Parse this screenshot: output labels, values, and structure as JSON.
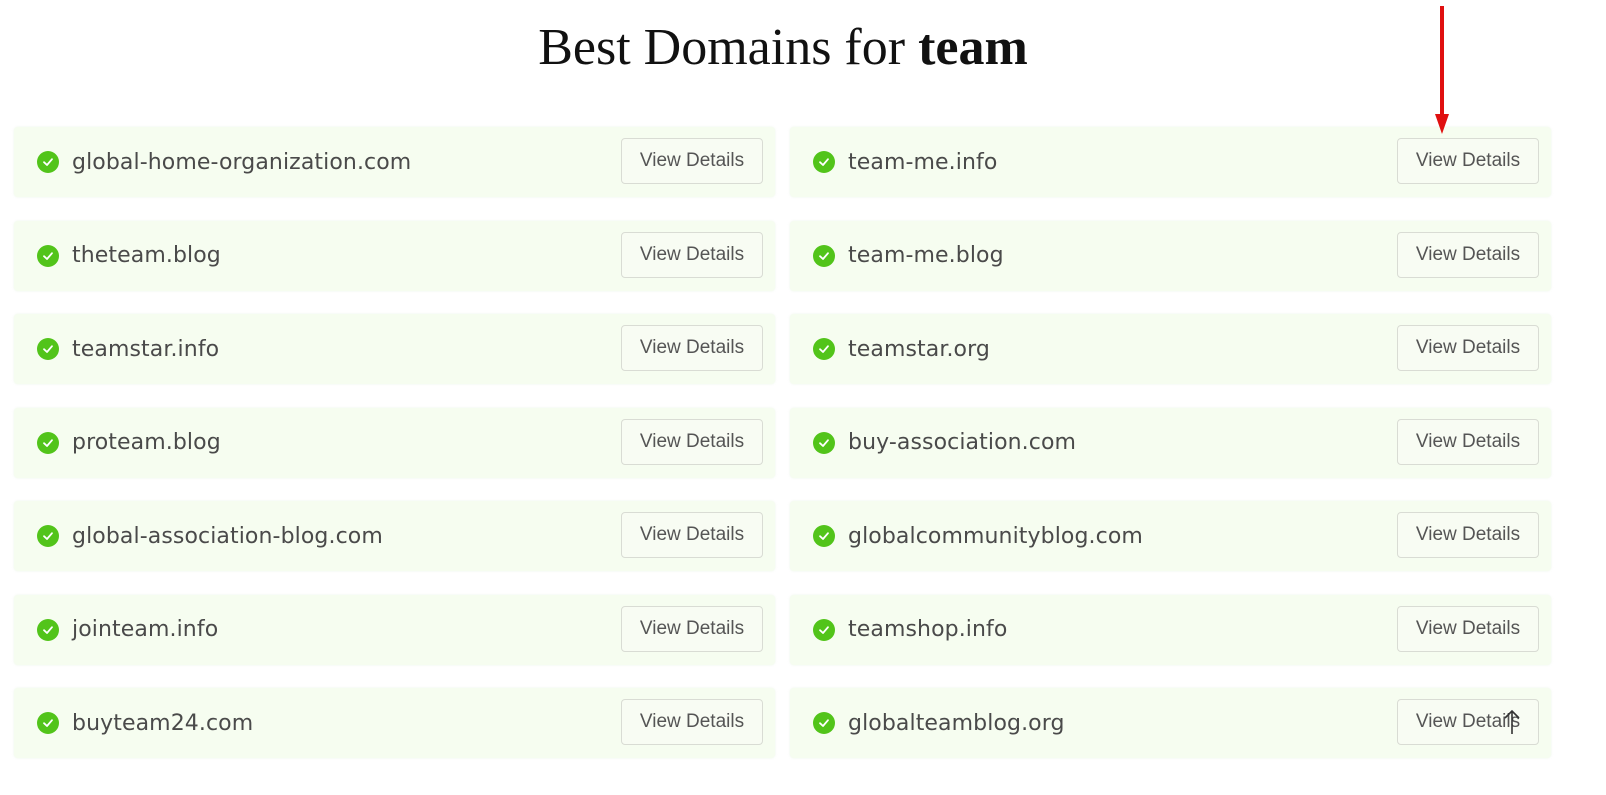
{
  "title": {
    "prefix": "Best Domains for ",
    "keyword": "team"
  },
  "button_label": "View Details",
  "status_icon": "check-circle-icon",
  "colors": {
    "accent_green": "#52c41a",
    "card_bg": "#f6fdf0",
    "annotation_red": "#e01010"
  },
  "domains": [
    {
      "name": "global-home-organization.com"
    },
    {
      "name": "team-me.info"
    },
    {
      "name": "theteam.blog"
    },
    {
      "name": "team-me.blog"
    },
    {
      "name": "teamstar.info"
    },
    {
      "name": "teamstar.org"
    },
    {
      "name": "proteam.blog"
    },
    {
      "name": "buy-association.com"
    },
    {
      "name": "global-association-blog.com"
    },
    {
      "name": "globalcommunityblog.com"
    },
    {
      "name": "jointeam.info"
    },
    {
      "name": "teamshop.info"
    },
    {
      "name": "buyteam24.com"
    },
    {
      "name": "globalteamblog.org"
    }
  ]
}
